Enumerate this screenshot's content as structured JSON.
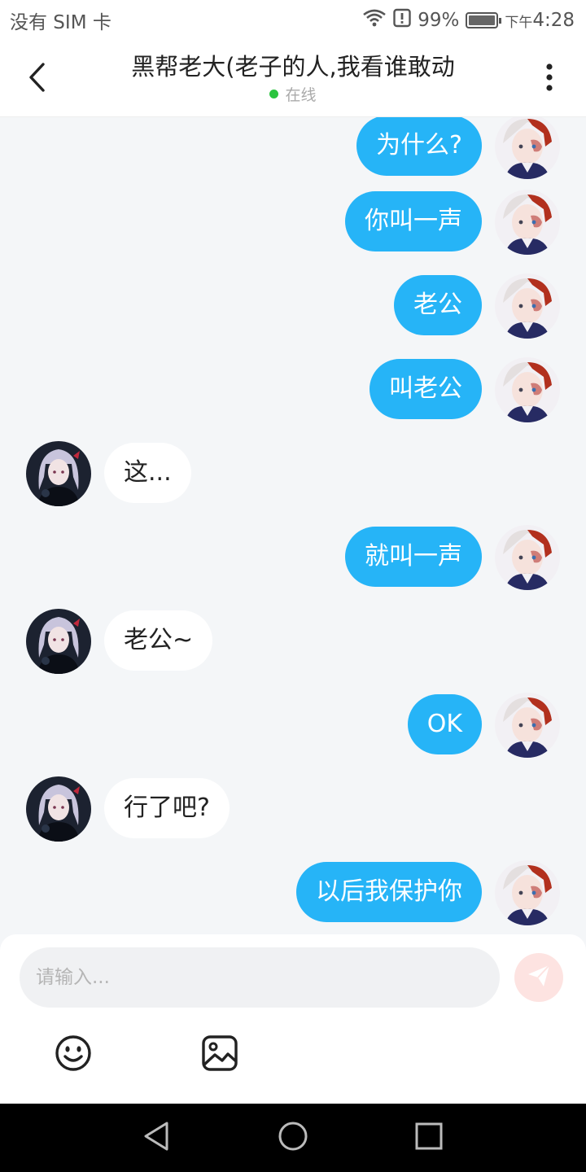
{
  "status_bar": {
    "carrier": "没有 SIM 卡",
    "battery_percent": "99%",
    "battery_level": 0.99,
    "time_prefix": "下午",
    "time": "4:28"
  },
  "header": {
    "title": "黑帮老大(老子的人,我看谁敢动",
    "status": "在线"
  },
  "messages": [
    {
      "side": "out",
      "text": "为什么?"
    },
    {
      "side": "out",
      "text": "你叫一声"
    },
    {
      "side": "out",
      "text": "老公"
    },
    {
      "side": "out",
      "text": "叫老公"
    },
    {
      "side": "in",
      "text": "这..."
    },
    {
      "side": "out",
      "text": "就叫一声"
    },
    {
      "side": "in",
      "text": "老公~"
    },
    {
      "side": "out",
      "text": "OK"
    },
    {
      "side": "in",
      "text": "行了吧?"
    },
    {
      "side": "out",
      "text": "以后我保护你"
    }
  ],
  "composer": {
    "placeholder": "请输入...",
    "value": ""
  },
  "icons": {
    "back": "chevron-left-icon",
    "more": "more-vertical-icon",
    "send": "send-icon",
    "emoji": "emoji-icon",
    "image": "image-icon",
    "nav_back": "triangle-back-icon",
    "nav_home": "circle-home-icon",
    "nav_recents": "square-recents-icon"
  },
  "colors": {
    "accent_bubble": "#26b4f7",
    "incoming_bubble": "#ffffff",
    "background": "#f4f6f8",
    "online": "#2bc43f",
    "send_button": "#fde3e1"
  }
}
